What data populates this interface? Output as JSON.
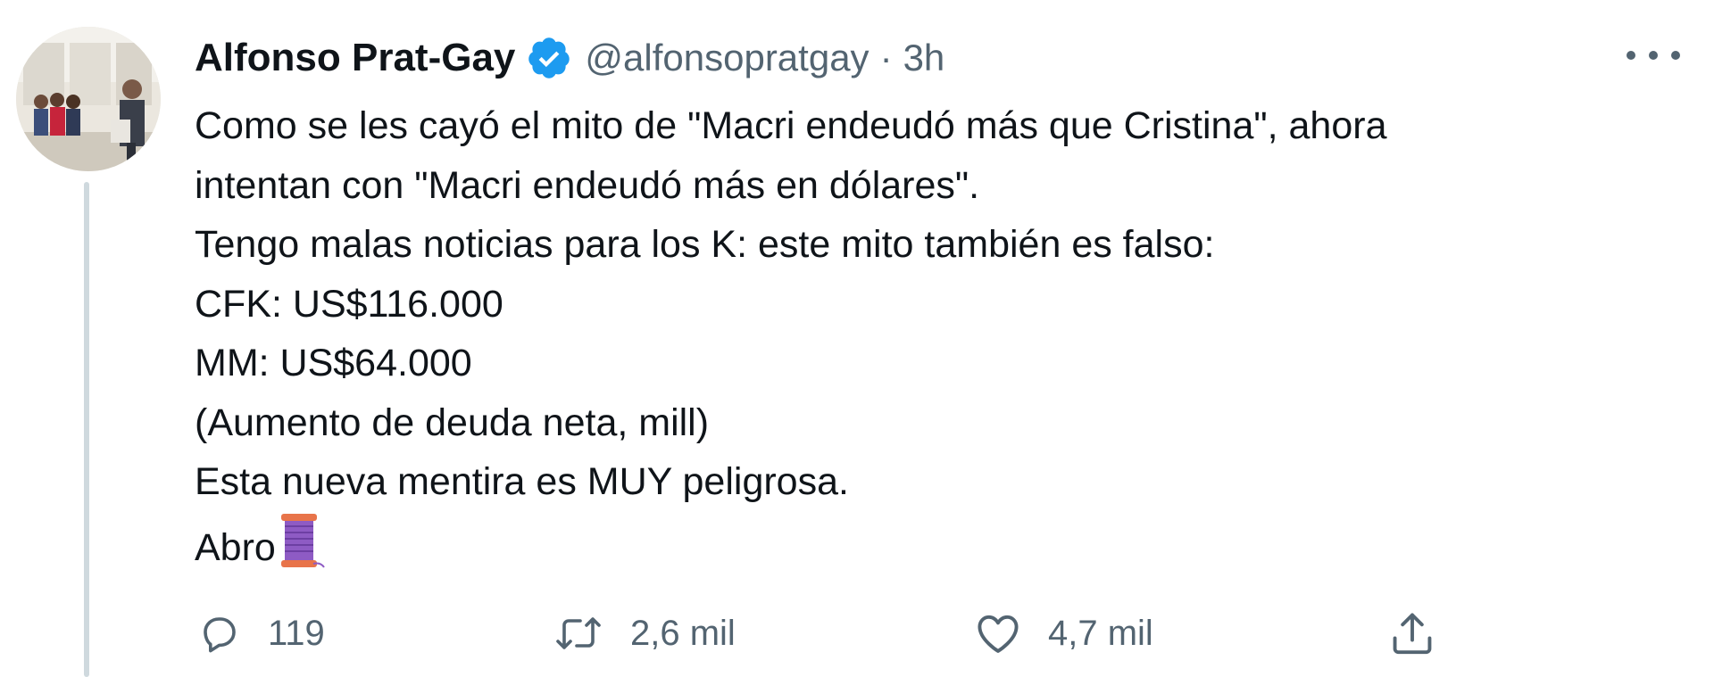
{
  "author": {
    "name": "Alfonso Prat-Gay",
    "verified": true,
    "handle": "@alfonsopratgay",
    "separator": "·",
    "time": "3h"
  },
  "tweet": {
    "lines": [
      "Como se les cayó el mito de \"Macri endeudó más que Cristina\", ahora",
      "intentan con \"Macri endeudó más en dólares\".",
      "Tengo malas noticias para los K: este mito también es falso:",
      "CFK: US$116.000",
      "MM: US$64.000",
      "(Aumento de deuda neta, mill)",
      "Esta nueva mentira es MUY peligrosa.",
      "Abro"
    ],
    "trailing_emoji": "thread-spool-icon"
  },
  "actions": {
    "reply": {
      "icon": "reply-icon",
      "count": "119"
    },
    "retweet": {
      "icon": "retweet-icon",
      "count": "2,6 mil"
    },
    "like": {
      "icon": "heart-icon",
      "count": "4,7 mil"
    },
    "share": {
      "icon": "share-icon"
    }
  },
  "colors": {
    "text": "#0f1419",
    "secondary": "#536471",
    "verified_badge": "#1d9bf0",
    "thread_line": "#cfd9de",
    "spool_thread": "#8e5bc4",
    "spool_wood": "#e8744a"
  }
}
